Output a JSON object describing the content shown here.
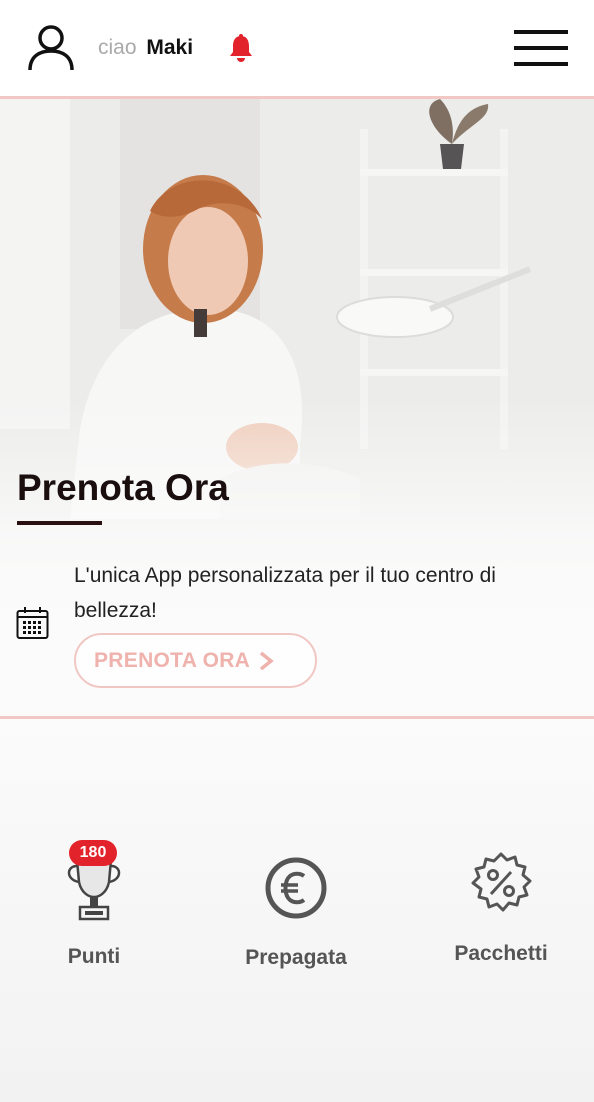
{
  "header": {
    "greeting": "ciao",
    "user_name": "Maki",
    "icons": {
      "user": "user-icon",
      "notification": "bell-icon",
      "menu": "hamburger-menu-icon"
    }
  },
  "hero": {
    "title": "Prenota Ora",
    "description": "L'unica App personalizzata per il tuo centro di bellezza!",
    "button_label": "PRENOTA ORA",
    "icons": {
      "calendar": "calendar-icon",
      "button": "chevron-right-icon"
    }
  },
  "shortcuts": [
    {
      "label": "Punti",
      "icon": "trophy-icon",
      "badge": "180"
    },
    {
      "label": "Prepagata",
      "icon": "euro-icon"
    },
    {
      "label": "Pacchetti",
      "icon": "discount-badge-icon"
    }
  ],
  "colors": {
    "accent": "#e3232c",
    "button_border": "#f1c7c3",
    "button_text": "#efb2ad",
    "divider": "#f2c8c4",
    "title": "#1a0e0e"
  }
}
